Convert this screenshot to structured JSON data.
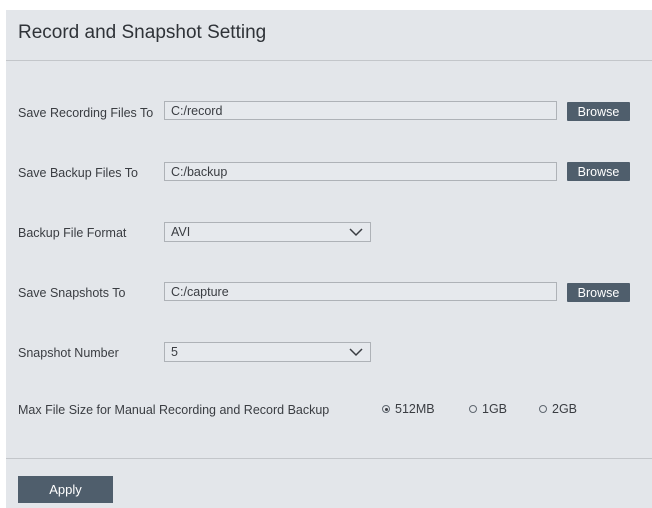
{
  "title": "Record and Snapshot Setting",
  "recording": {
    "label": "Save Recording Files To",
    "value": "C:/record",
    "browse": "Browse"
  },
  "backup": {
    "label": "Save Backup Files To",
    "value": "C:/backup",
    "browse": "Browse"
  },
  "format": {
    "label": "Backup File Format",
    "value": "AVI"
  },
  "snapshots": {
    "label": "Save Snapshots To",
    "value": "C:/capture",
    "browse": "Browse"
  },
  "snapshot_number": {
    "label": "Snapshot Number",
    "value": "5"
  },
  "max_size": {
    "label": "Max File Size for Manual Recording and Record Backup",
    "options": [
      "512MB",
      "1GB",
      "2GB"
    ],
    "selected": "512MB"
  },
  "apply": "Apply",
  "icons": {
    "dropdown": "chevron-down-icon",
    "radio_checked": "radio-checked-icon",
    "radio_unchecked": "radio-unchecked-icon"
  }
}
